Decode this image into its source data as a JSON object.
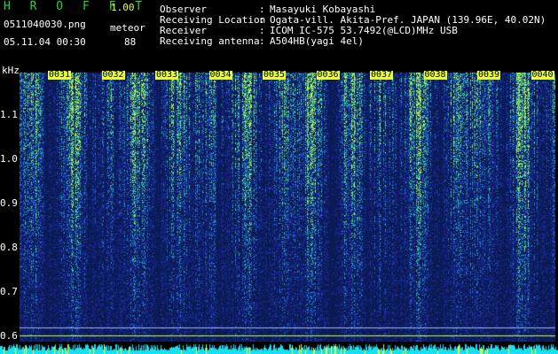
{
  "header": {
    "app_title": "H R O F F T",
    "version": "1.00",
    "filename": "0511040030.png",
    "datetime": "05.11.04 00:30",
    "detector_label": "meteor",
    "detector_count": "88"
  },
  "station_info": [
    {
      "label": "Observer",
      "value": "Masayuki Kobayashi"
    },
    {
      "label": "Receiving Location",
      "value": "Ogata-vill. Akita-Pref. JAPAN (139.96E, 40.02N)"
    },
    {
      "label": "Receiver",
      "value": "ICOM IC-575 53.7492(@LCD)MHz USB"
    },
    {
      "label": "Receiving antenna",
      "value": "A504HB(yagi 4el)"
    }
  ],
  "spectrogram": {
    "y_unit": "kHz",
    "y_ticks": [
      {
        "label": "1.1",
        "value": 1.1
      },
      {
        "label": "1.0",
        "value": 1.0
      },
      {
        "label": "0.9",
        "value": 0.9
      },
      {
        "label": "0.8",
        "value": 0.8
      },
      {
        "label": "0.7",
        "value": 0.7
      },
      {
        "label": "0.6",
        "value": 0.6
      }
    ],
    "time_marks": [
      "0031",
      "0032",
      "0033",
      "0034",
      "0035",
      "0036",
      "0037",
      "0038",
      "0039",
      "0040"
    ],
    "colors": {
      "background": "#0a1a52",
      "low": "#1e2fae",
      "mid": "#1f8fd6",
      "high": "#3fe07a",
      "peak": "#c8ff3a",
      "marker": "#e8ff3a",
      "strip": "#19e0f0"
    }
  }
}
